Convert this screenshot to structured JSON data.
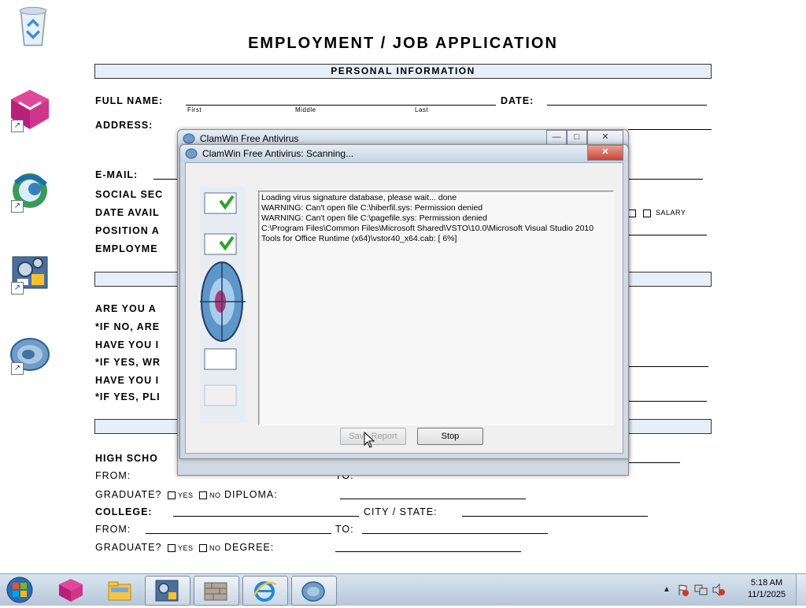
{
  "form": {
    "title": "EMPLOYMENT / JOB APPLICATION",
    "section_personal": "PERSONAL INFORMATION",
    "full_name": "FULL NAME:",
    "first": "First",
    "middle": "Middle",
    "last": "Last",
    "date": "DATE:",
    "address": "ADDRESS:",
    "email": "E-MAIL:",
    "social": "SOCIAL SEC",
    "date_avail": "DATE AVAIL",
    "position": "POSITION A",
    "employment": "EMPLOYME",
    "salary": "SALARY",
    "are_you": "ARE YOU A",
    "if_no": "*IF NO, ARE",
    "have_you_1": "HAVE YOU I",
    "if_yes_wr": "*IF YES, WR",
    "have_you_2": "HAVE YOU I",
    "if_yes_pl": "*IF YES, PLI",
    "high_school": "HIGH SCHO",
    "from": "FROM:",
    "to": "TO:",
    "graduate": "GRADUATE?",
    "yes": "YES",
    "no": "NO",
    "diploma": "DIPLOMA:",
    "college": "COLLEGE:",
    "city_state": "CITY / STATE:",
    "degree": "DEGREE:"
  },
  "desktop_icons": [
    {
      "name": "recycle-bin-icon"
    },
    {
      "name": "app-shortcut-pink-icon"
    },
    {
      "name": "globe-shortcut-icon"
    },
    {
      "name": "settings-shortcut-icon"
    },
    {
      "name": "clamwin-shortcut-icon"
    }
  ],
  "main_window": {
    "title": "ClamWin Free Antivirus",
    "minimize": "—",
    "maximize": "□",
    "close": "✕"
  },
  "scan_dialog": {
    "title": "ClamWin Free Antivirus: Scanning...",
    "close": "✕",
    "log": "Loading virus signature database, please wait... done\nWARNING: Can't open file C:\\hiberfil.sys: Permission denied\nWARNING: Can't open file C:\\pagefile.sys: Permission denied\nC:\\Program Files\\Common Files\\Microsoft Shared\\VSTO\\10.0\\Microsoft Visual Studio 2010\nTools for Office Runtime (x64)\\vstor40_x64.cab: [ 6%]",
    "save_report": "Save Report",
    "stop": "Stop"
  },
  "taskbar": {
    "items": [
      "pink-app-icon",
      "folder-icon",
      "settings-icon",
      "firewall-icon",
      "internet-explorer-icon",
      "clamwin-icon"
    ],
    "time": "5:18 AM",
    "date": "11/1/2025"
  },
  "colors": {
    "taskbar": "#b6c6d8",
    "dialog_frame": "#cfd8e3",
    "close_button": "#c6463a"
  }
}
